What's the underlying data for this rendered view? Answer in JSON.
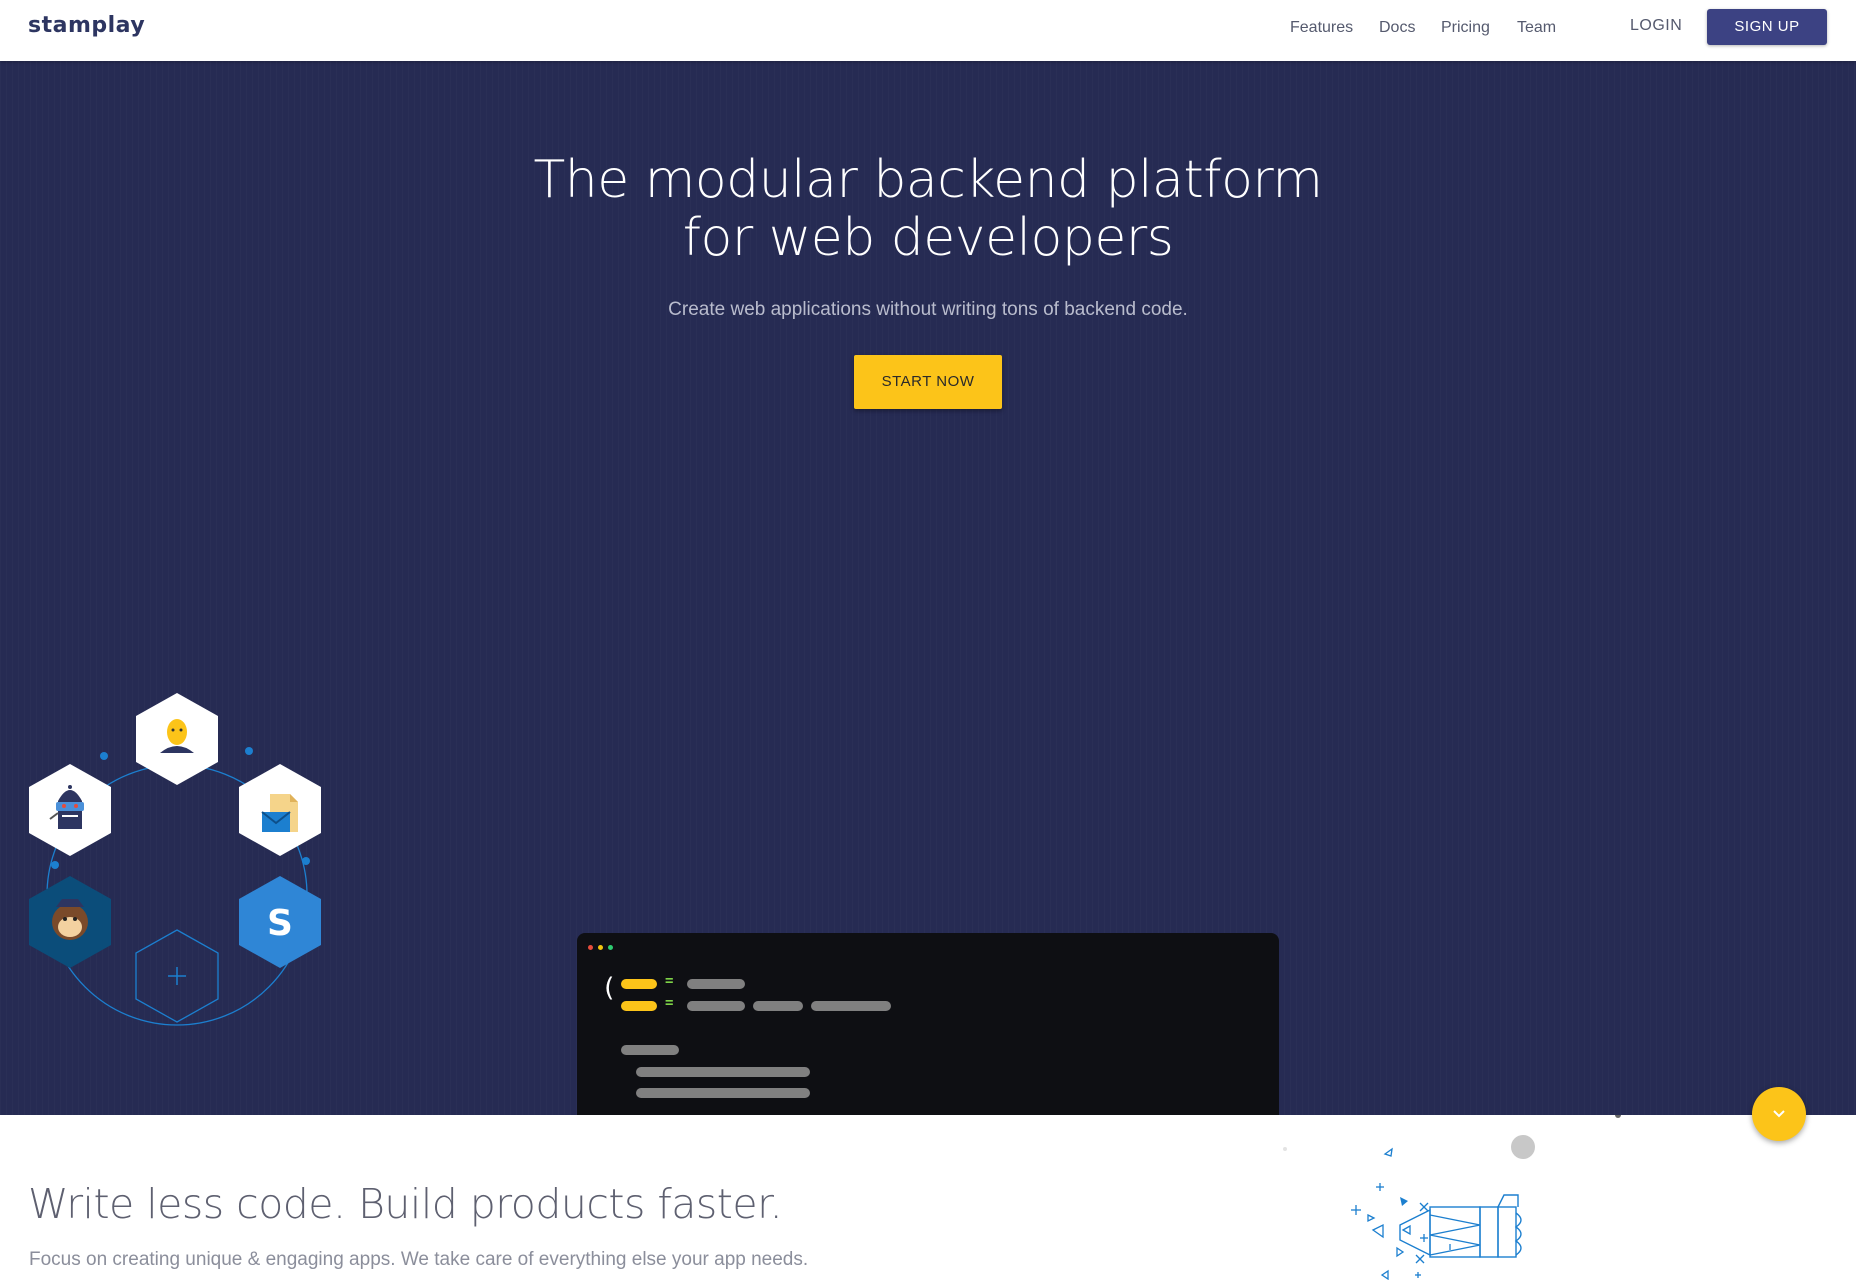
{
  "nav": {
    "logo": "stamplay",
    "links": [
      "Features",
      "Docs",
      "Pricing",
      "Team"
    ],
    "login": "LOGIN",
    "signup": "SIGN UP"
  },
  "hero": {
    "title_line1": "The modular backend platform",
    "title_line2": "for web developers",
    "subtitle": "Create web applications without writing tons of backend code.",
    "cta": "START NOW",
    "integrations": [
      "user-icon",
      "mail-file-icon",
      "stripe-icon",
      "add-icon",
      "mailchimp-icon",
      "robot-icon"
    ],
    "stripe_glyph": "S"
  },
  "features": {
    "title": "Write less code. Build products faster.",
    "subtitle": "Focus on creating unique & engaging apps. We take care of everything else your app needs."
  },
  "colors": {
    "brand": "#2d3561",
    "hero_bg": "#262b53",
    "accent": "#fcc419",
    "signup_bg": "#3c4283",
    "hex_blue": "#1c7fcf"
  }
}
